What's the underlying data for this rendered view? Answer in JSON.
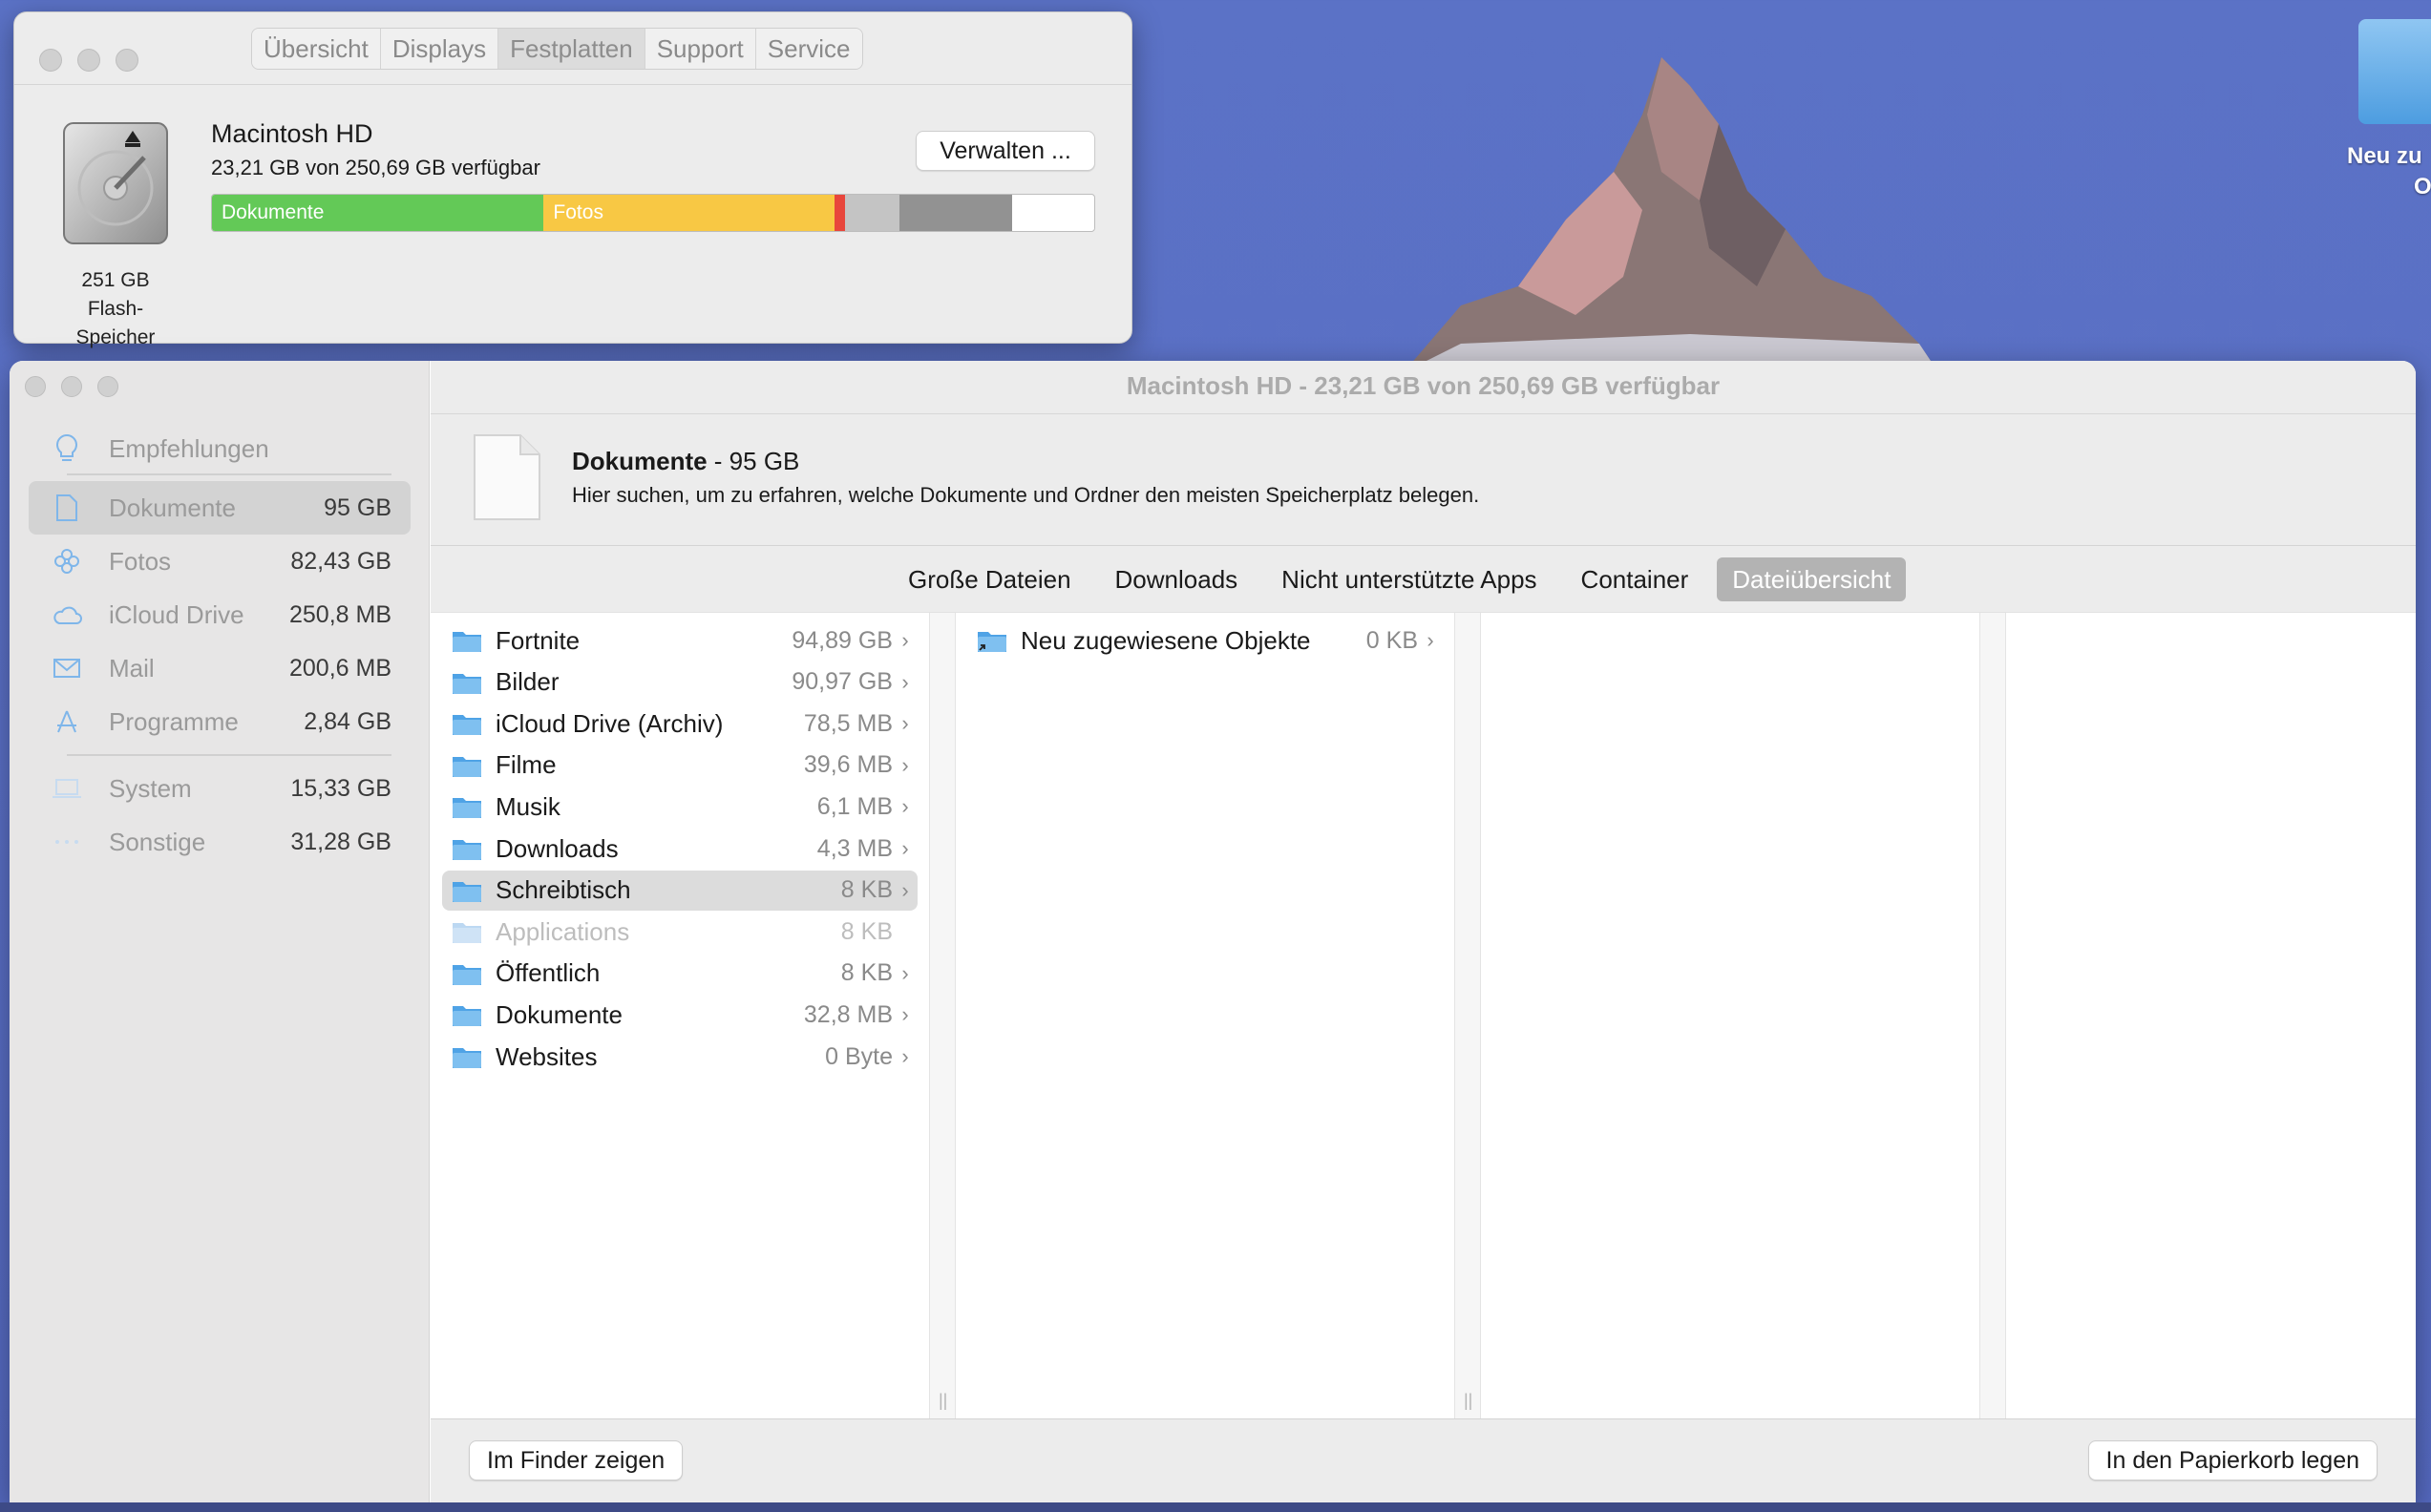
{
  "desktop": {
    "icon_label_line1": "Neu zu",
    "icon_label_line2": "O"
  },
  "system_info": {
    "tabs": [
      "Übersicht",
      "Displays",
      "Festplatten",
      "Support",
      "Service"
    ],
    "active_tab": "Festplatten",
    "disk_name": "Macintosh HD",
    "disk_available": "23,21 GB von 250,69 GB verfügbar",
    "disk_capacity": "251 GB",
    "disk_type": "Flash-Speicher",
    "manage_button": "Verwalten ...",
    "storage_bar": [
      {
        "label": "Dokumente",
        "color": "#63c957",
        "fraction": 0.376
      },
      {
        "label": "Fotos",
        "color": "#f8c844",
        "fraction": 0.33
      },
      {
        "label": "",
        "color": "#e8463c",
        "fraction": 0.012
      },
      {
        "label": "",
        "color": "#c4c4c4",
        "fraction": 0.061
      },
      {
        "label": "",
        "color": "#929292",
        "fraction": 0.128
      }
    ]
  },
  "storage_window": {
    "title": "Macintosh HD - 23,21 GB von 250,69 GB verfügbar",
    "sidebar": {
      "recommendations": "Empfehlungen",
      "items": [
        {
          "label": "Dokumente",
          "value": "95 GB",
          "icon": "document-icon"
        },
        {
          "label": "Fotos",
          "value": "82,43 GB",
          "icon": "photos-icon"
        },
        {
          "label": "iCloud Drive",
          "value": "250,8 MB",
          "icon": "cloud-icon"
        },
        {
          "label": "Mail",
          "value": "200,6 MB",
          "icon": "mail-icon"
        },
        {
          "label": "Programme",
          "value": "2,84 GB",
          "icon": "apps-icon"
        }
      ],
      "system_items": [
        {
          "label": "System",
          "value": "15,33 GB",
          "icon": "laptop-icon"
        },
        {
          "label": "Sonstige",
          "value": "31,28 GB",
          "icon": "ellipsis-icon"
        }
      ]
    },
    "header": {
      "title": "Dokumente",
      "size": " - 95 GB",
      "description": "Hier suchen, um zu erfahren, welche Dokumente und Ordner den meisten Speicherplatz belegen."
    },
    "tabs": [
      "Große Dateien",
      "Downloads",
      "Nicht unterstützte Apps",
      "Container",
      "Dateiübersicht"
    ],
    "active_tab": "Dateiübersicht",
    "column1": [
      {
        "name": "Fortnite",
        "size": "94,89 GB",
        "chevron": true
      },
      {
        "name": "Bilder",
        "size": "90,97 GB",
        "chevron": true
      },
      {
        "name": "iCloud Drive (Archiv)",
        "size": "78,5 MB",
        "chevron": true
      },
      {
        "name": "Filme",
        "size": "39,6 MB",
        "chevron": true
      },
      {
        "name": "Musik",
        "size": "6,1 MB",
        "chevron": true
      },
      {
        "name": "Downloads",
        "size": "4,3 MB",
        "chevron": true
      },
      {
        "name": "Schreibtisch",
        "size": "8 KB",
        "chevron": true,
        "selected": true
      },
      {
        "name": "Applications",
        "size": "8 KB",
        "chevron": false,
        "dim": true
      },
      {
        "name": "Öffentlich",
        "size": "8 KB",
        "chevron": true
      },
      {
        "name": "Dokumente",
        "size": "32,8 MB",
        "chevron": true
      },
      {
        "name": "Websites",
        "size": "0 Byte",
        "chevron": true
      }
    ],
    "column2": [
      {
        "name": "Neu zugewiesene Objekte",
        "size": "0 KB",
        "chevron": true
      }
    ],
    "footer": {
      "show_in_finder": "Im Finder zeigen",
      "move_to_trash": "In den Papierkorb legen"
    }
  }
}
